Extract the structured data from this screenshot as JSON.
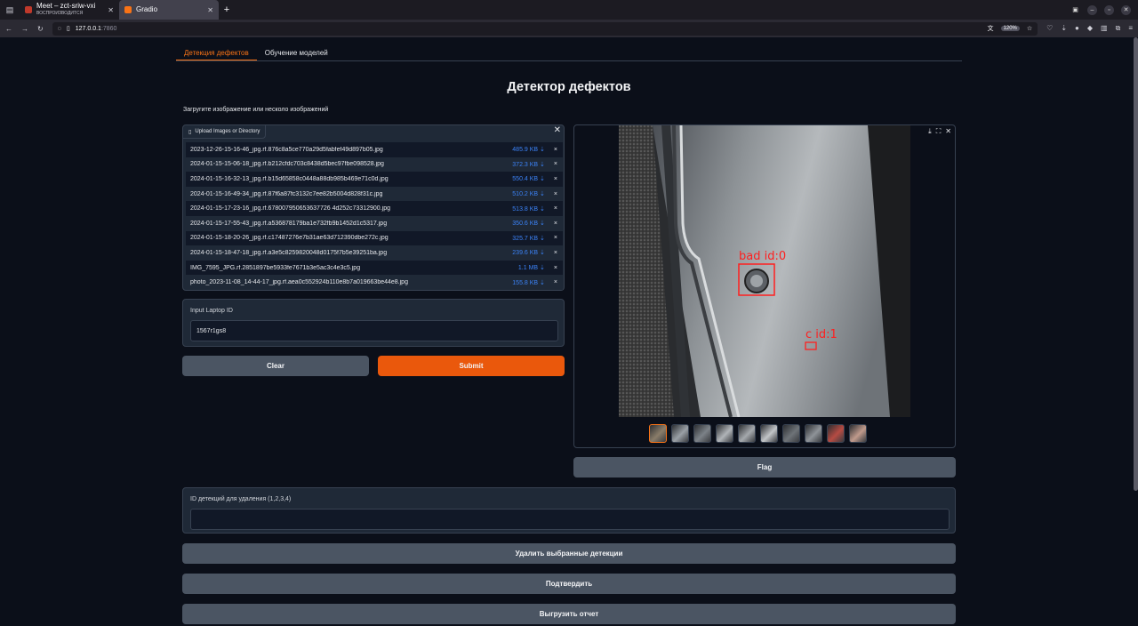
{
  "browser": {
    "tabs": [
      {
        "title": "Meet – zct-sriw-vxi",
        "subtitle": "ВОСПРОИЗВОДИТСЯ",
        "active": false
      },
      {
        "title": "Gradio",
        "subtitle": "",
        "active": true
      }
    ],
    "url_host": "127.0.0.1",
    "url_port": ":7860",
    "zoom": "120%"
  },
  "app": {
    "tabs": [
      "Детекция дефектов",
      "Обучение моделей"
    ],
    "title": "Детектор дефектов",
    "subtitle": "Загругите изображение или несколо изображений"
  },
  "uploader": {
    "label": "Upload Images or Directory",
    "files": [
      {
        "name": "2023-12-26-15-16-46_jpg.rf.876c8a5ce770a29d5fabfef49d897b05.jpg",
        "size": "485.9 KB ⇣"
      },
      {
        "name": "2024-01-15-15-06-18_jpg.rf.b212cfdc703c8438d5bec97fbe098528.jpg",
        "size": "372.3 KB ⇣"
      },
      {
        "name": "2024-01-15-16-32-13_jpg.rf.b15d65858c0448a88db985b469e71c0d.jpg",
        "size": "550.4 KB ⇣"
      },
      {
        "name": "2024-01-15-16-49-34_jpg.rf.87f6a87fc3132c7ee82b5004d828f31c.jpg",
        "size": "510.2 KB ⇣"
      },
      {
        "name": "2024-01-15-17-23-16_jpg.rf.678007950653637726 4d252c73312900.jpg",
        "size": "513.8 KB ⇣"
      },
      {
        "name": "2024-01-15-17-55-43_jpg.rf.a536878179ba1e732fb9b1452d1c5317.jpg",
        "size": "350.6 KB ⇣"
      },
      {
        "name": "2024-01-15-18-20-26_jpg.rf.c17487276e7b31ae63d712390dbe272c.jpg",
        "size": "325.7 KB ⇣"
      },
      {
        "name": "2024-01-15-18-47-18_jpg.rf.a3e5c8259820048d0175f7b5e39251ba.jpg",
        "size": "239.6 KB ⇣"
      },
      {
        "name": "IMG_7595_JPG.rf.2851897be5933fe7671b3e5ac3c4e3c5.jpg",
        "size": "1.1 MB ⇣"
      },
      {
        "name": "photo_2023-11-08_14-44-17_jpg.rf.aea0c552924b110e8b7a019663be44e8.jpg",
        "size": "155.8 KB ⇣"
      }
    ]
  },
  "laptop": {
    "label": "Input Laptop ID",
    "value": "1567r1gs8"
  },
  "buttons": {
    "clear": "Clear",
    "submit": "Submit",
    "flag": "Flag",
    "delete": "Удалить выбранные детекции",
    "confirm": "Подтвердить",
    "export": "Выгрузить отчет"
  },
  "gallery": {
    "detections": [
      {
        "label": "bad id:0"
      },
      {
        "label": "c id:1"
      }
    ],
    "thumb_count": 10,
    "selected_thumb": 0
  },
  "detections_field": {
    "label": "ID детекций для удаления (1,2,3,4)",
    "value": ""
  }
}
